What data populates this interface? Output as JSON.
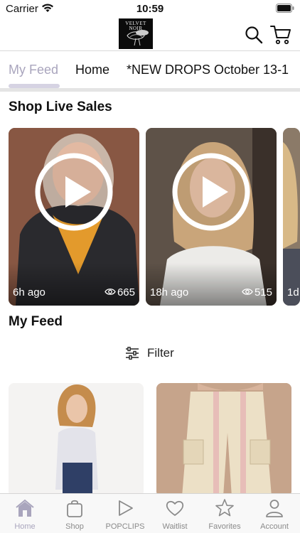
{
  "status_bar": {
    "carrier": "Carrier",
    "time": "10:59"
  },
  "header": {
    "logo_text_line1": "VELVET",
    "logo_text_line2": "NOIR"
  },
  "tabs": [
    {
      "label": "My Feed",
      "active": true
    },
    {
      "label": "Home",
      "active": false
    },
    {
      "label": "*NEW DROPS October 13-1",
      "active": false
    }
  ],
  "live_sales": {
    "title": "Shop Live Sales",
    "cards": [
      {
        "time": "6h ago",
        "views": "665"
      },
      {
        "time": "18h ago",
        "views": "515"
      },
      {
        "time": "1d",
        "views": ""
      }
    ]
  },
  "my_feed": {
    "title": "My Feed",
    "filter_label": "Filter"
  },
  "bottom_nav": [
    {
      "label": "Home",
      "icon": "home-icon",
      "active": true
    },
    {
      "label": "Shop",
      "icon": "bag-icon",
      "active": false
    },
    {
      "label": "POPCLIPS",
      "icon": "play-icon",
      "active": false
    },
    {
      "label": "Waitlist",
      "icon": "heart-icon",
      "active": false
    },
    {
      "label": "Favorites",
      "icon": "star-icon",
      "active": false
    },
    {
      "label": "Account",
      "icon": "person-icon",
      "active": false
    }
  ],
  "colors": {
    "accent": "#a9a5bd",
    "tab_underline": "#d6d3e3",
    "text": "#111111"
  }
}
